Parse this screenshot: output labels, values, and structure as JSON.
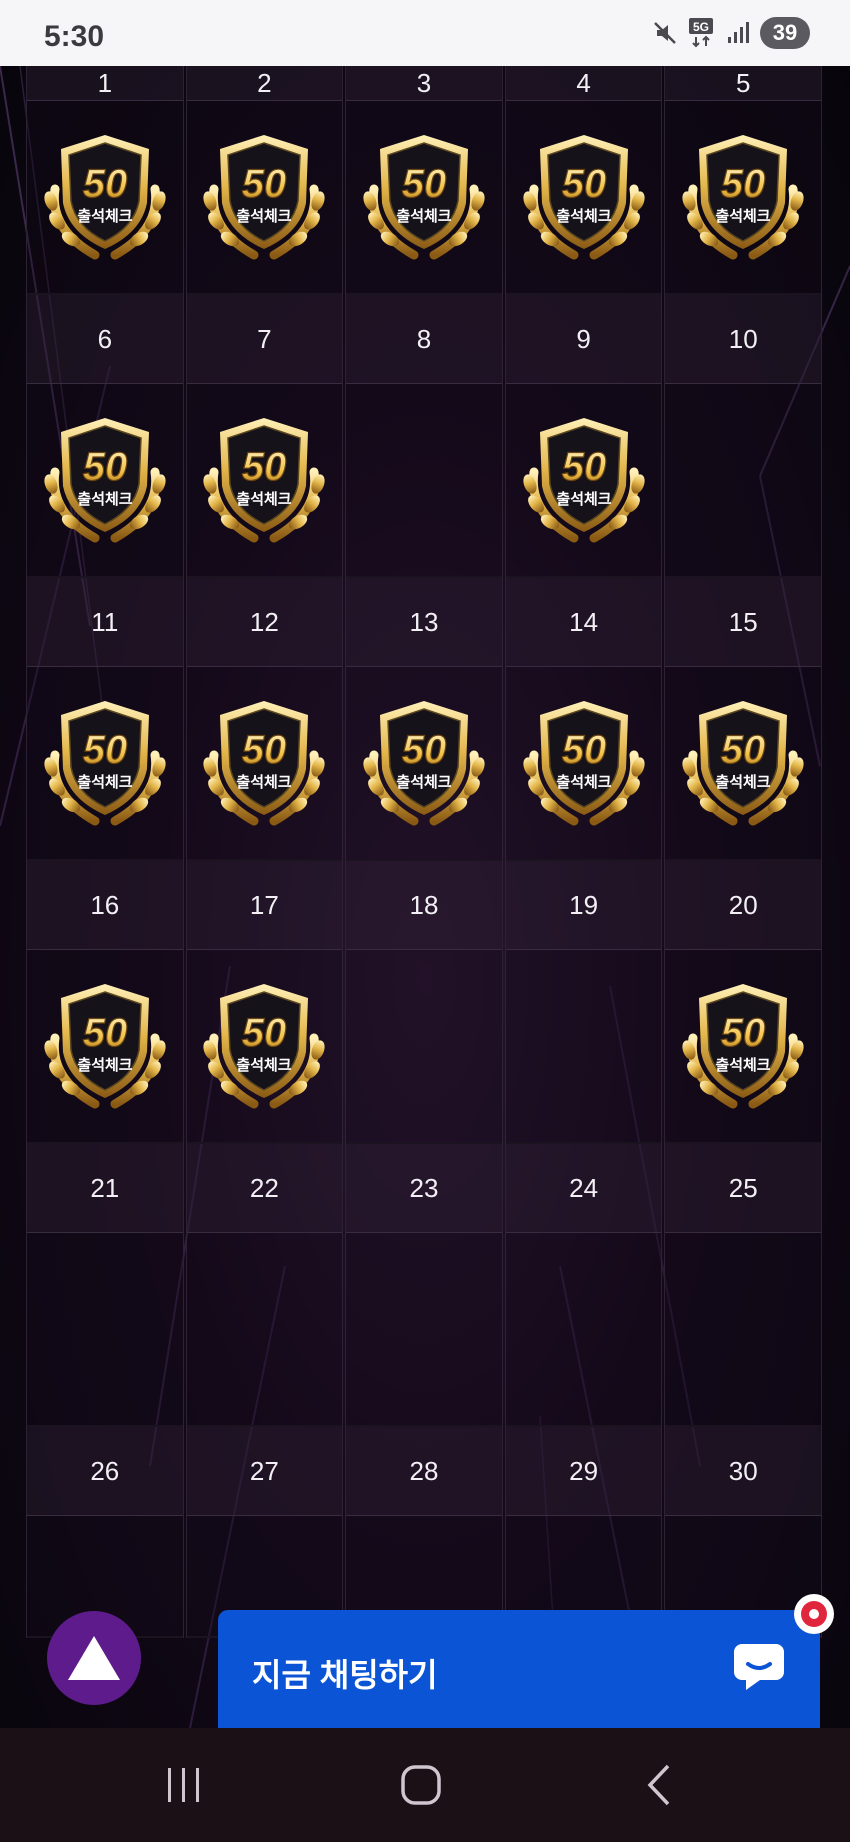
{
  "status_bar": {
    "time": "5:30",
    "network": "5G",
    "battery": "39",
    "icons": [
      "mute-icon",
      "network-5g-icon",
      "signal-icon",
      "battery-icon"
    ]
  },
  "badge": {
    "number": "50",
    "text": "출석체크"
  },
  "calendar": {
    "days": [
      {
        "day": "1",
        "checked": true
      },
      {
        "day": "2",
        "checked": true
      },
      {
        "day": "3",
        "checked": true
      },
      {
        "day": "4",
        "checked": true
      },
      {
        "day": "5",
        "checked": true
      },
      {
        "day": "6",
        "checked": true
      },
      {
        "day": "7",
        "checked": true
      },
      {
        "day": "8",
        "checked": false
      },
      {
        "day": "9",
        "checked": true
      },
      {
        "day": "10",
        "checked": false
      },
      {
        "day": "11",
        "checked": true
      },
      {
        "day": "12",
        "checked": true
      },
      {
        "day": "13",
        "checked": true
      },
      {
        "day": "14",
        "checked": true
      },
      {
        "day": "15",
        "checked": true
      },
      {
        "day": "16",
        "checked": true
      },
      {
        "day": "17",
        "checked": true
      },
      {
        "day": "18",
        "checked": false
      },
      {
        "day": "19",
        "checked": false
      },
      {
        "day": "20",
        "checked": true
      },
      {
        "day": "21",
        "checked": false
      },
      {
        "day": "22",
        "checked": false
      },
      {
        "day": "23",
        "checked": false
      },
      {
        "day": "24",
        "checked": false
      },
      {
        "day": "25",
        "checked": false
      },
      {
        "day": "26",
        "checked": false
      },
      {
        "day": "27",
        "checked": false
      },
      {
        "day": "28",
        "checked": false
      },
      {
        "day": "29",
        "checked": false
      },
      {
        "day": "30",
        "checked": false
      }
    ]
  },
  "chat": {
    "label": "지금 채팅하기",
    "icon": "chat-bubble-icon"
  },
  "scroll_top": {
    "icon": "triangle-up-icon"
  },
  "nav": {
    "icons": [
      "recent-apps-icon",
      "home-icon",
      "back-icon"
    ]
  },
  "colors": {
    "chat_blue": "#0c54d6",
    "fab_purple": "#5e1b8c",
    "badge_gold": "#e3b64a",
    "notification_red": "#e0263c"
  }
}
